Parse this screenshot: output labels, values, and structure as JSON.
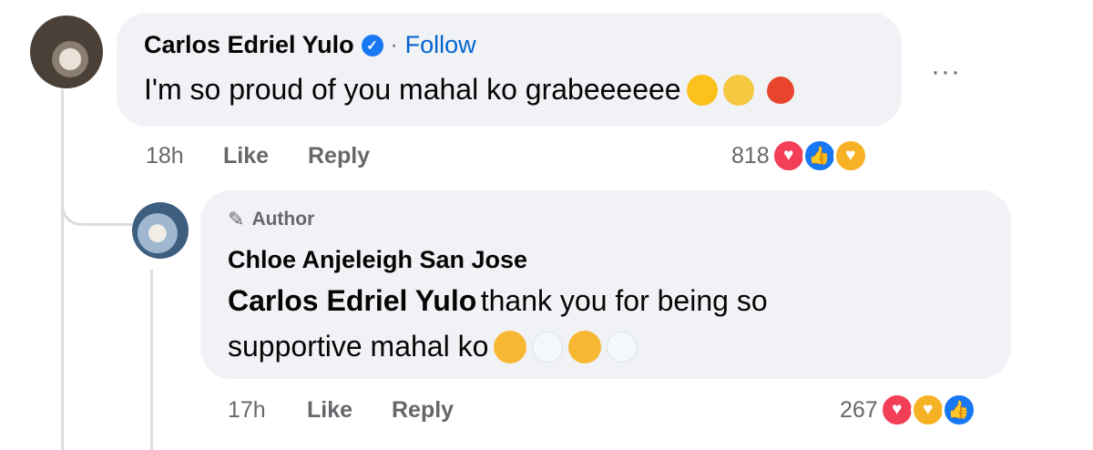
{
  "comment1": {
    "author": "Carlos Edriel Yulo",
    "separator": "·",
    "follow_label": "Follow",
    "text": "I'm so proud of you mahal ko grabeeeeee",
    "emojis": [
      "heart-eyes-emoji",
      "party-face-emoji",
      "burning-heart-emoji"
    ],
    "time": "18h",
    "like_label": "Like",
    "reply_label": "Reply",
    "reaction_count": "818",
    "reactions": [
      "love",
      "like",
      "care"
    ],
    "more_label": "···"
  },
  "reply1": {
    "badge": "Author",
    "author": "Chloe Anjeleigh San Jose",
    "mention": "Carlos Edriel Yulo",
    "text_line1": "thank you for being so",
    "text_line2": "supportive mahal ko",
    "emojis": [
      "pleading-face-emoji",
      "white-heart-emoji",
      "pleading-face-emoji",
      "white-heart-emoji"
    ],
    "time": "17h",
    "like_label": "Like",
    "reply_label": "Reply",
    "reaction_count": "267",
    "reactions": [
      "love",
      "care",
      "like"
    ]
  },
  "colors": {
    "bubble": "#f0f2f5",
    "link": "#0064d1",
    "secondary_text": "#65676b",
    "love": "#f33e58",
    "like": "#1877f2",
    "care": "#f7b125"
  }
}
